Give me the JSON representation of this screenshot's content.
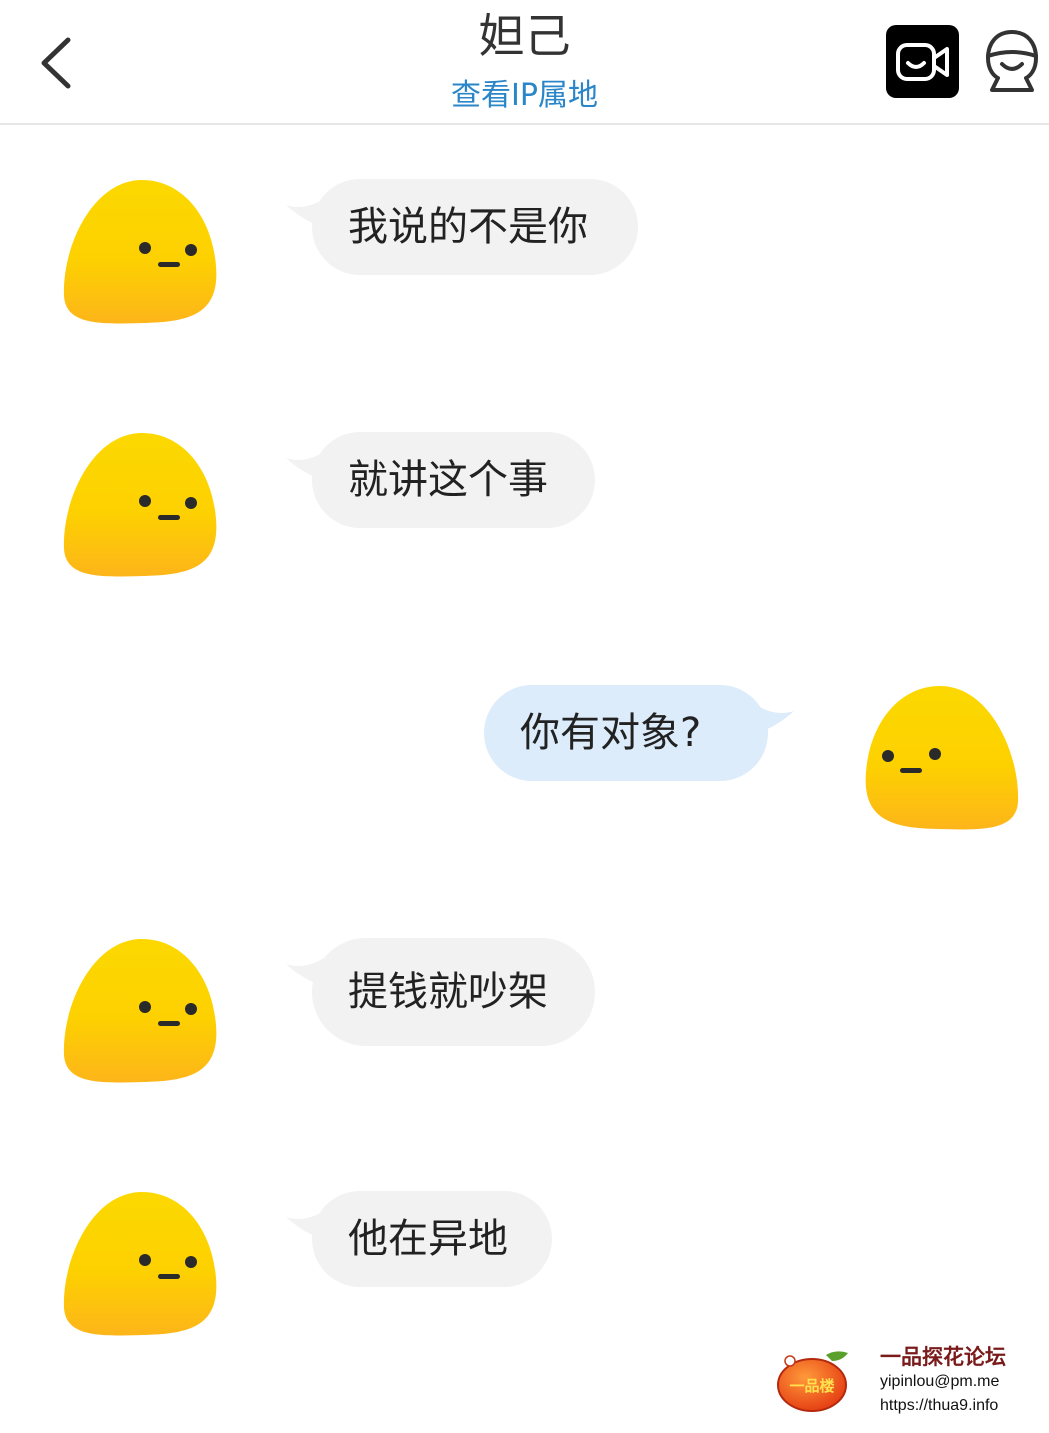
{
  "header": {
    "title": "妲己",
    "subtitle": "查看IP属地"
  },
  "messages": [
    {
      "side": "left",
      "text": "我说的不是你"
    },
    {
      "side": "left",
      "text": "就讲这个事"
    },
    {
      "side": "right",
      "text": "你有对象?"
    },
    {
      "side": "left",
      "text": "提钱就吵架"
    },
    {
      "side": "left",
      "text": "他在异地"
    }
  ],
  "watermark": {
    "logo_text": "一品楼",
    "title": "一品探花论坛",
    "email": "yipinlou@pm.me",
    "url": "https://thua9.info"
  },
  "colors": {
    "link": "#2a86c9",
    "bubble_in": "#f2f2f2",
    "bubble_out": "#dcecfb",
    "avatar_top": "#fcd800",
    "avatar_bottom": "#fdb51a"
  },
  "icons": {
    "back": "chevron-left-icon",
    "video": "video-call-icon",
    "profile": "profile-icon"
  }
}
